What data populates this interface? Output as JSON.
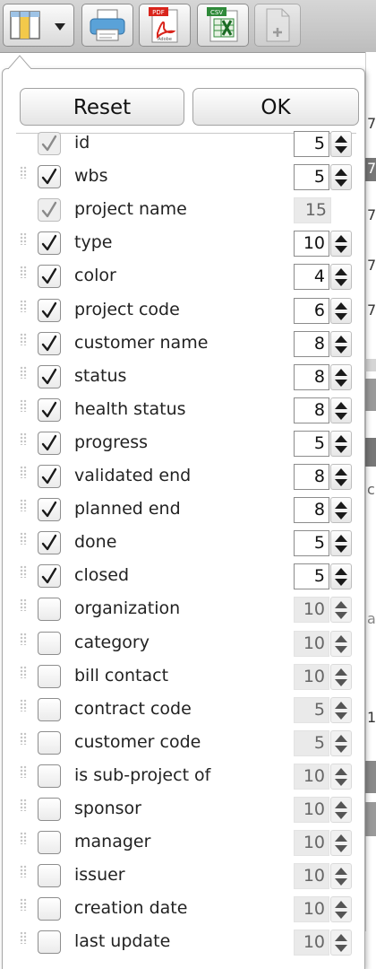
{
  "toolbar": {
    "buttons": [
      {
        "icon": "column-selector-icon",
        "has_dropdown": true
      },
      {
        "icon": "printer-icon"
      },
      {
        "icon": "pdf-export-icon",
        "badge": "PDF",
        "sub": "Adobe"
      },
      {
        "icon": "csv-export-icon",
        "badge": "CSV"
      },
      {
        "icon": "new-document-icon",
        "disabled": true
      }
    ]
  },
  "background": {
    "fragments": [
      "7",
      "7",
      "7",
      "7",
      "7",
      "c",
      "a",
      "1"
    ]
  },
  "popup": {
    "reset_label": "Reset",
    "ok_label": "OK",
    "columns": [
      {
        "label": "id",
        "checked": true,
        "locked": true,
        "width": "5",
        "editable": true
      },
      {
        "label": "wbs",
        "checked": true,
        "locked": false,
        "width": "5",
        "editable": true
      },
      {
        "label": "project name",
        "checked": true,
        "locked": true,
        "width": "15",
        "editable": false
      },
      {
        "label": "type",
        "checked": true,
        "locked": false,
        "width": "10",
        "editable": true
      },
      {
        "label": "color",
        "checked": true,
        "locked": false,
        "width": "4",
        "editable": true
      },
      {
        "label": "project code",
        "checked": true,
        "locked": false,
        "width": "6",
        "editable": true
      },
      {
        "label": "customer name",
        "checked": true,
        "locked": false,
        "width": "8",
        "editable": true
      },
      {
        "label": "status",
        "checked": true,
        "locked": false,
        "width": "8",
        "editable": true
      },
      {
        "label": "health status",
        "checked": true,
        "locked": false,
        "width": "8",
        "editable": true
      },
      {
        "label": "progress",
        "checked": true,
        "locked": false,
        "width": "5",
        "editable": true
      },
      {
        "label": "validated end",
        "checked": true,
        "locked": false,
        "width": "8",
        "editable": true
      },
      {
        "label": "planned end",
        "checked": true,
        "locked": false,
        "width": "8",
        "editable": true
      },
      {
        "label": "done",
        "checked": true,
        "locked": false,
        "width": "5",
        "editable": true
      },
      {
        "label": "closed",
        "checked": true,
        "locked": false,
        "width": "5",
        "editable": true
      },
      {
        "label": "organization",
        "checked": false,
        "locked": false,
        "width": "10",
        "editable": false
      },
      {
        "label": "category",
        "checked": false,
        "locked": false,
        "width": "10",
        "editable": false
      },
      {
        "label": "bill contact",
        "checked": false,
        "locked": false,
        "width": "10",
        "editable": false
      },
      {
        "label": "contract code",
        "checked": false,
        "locked": false,
        "width": "5",
        "editable": false
      },
      {
        "label": "customer code",
        "checked": false,
        "locked": false,
        "width": "5",
        "editable": false
      },
      {
        "label": "is sub-project of",
        "checked": false,
        "locked": false,
        "width": "10",
        "editable": false
      },
      {
        "label": "sponsor",
        "checked": false,
        "locked": false,
        "width": "10",
        "editable": false
      },
      {
        "label": "manager",
        "checked": false,
        "locked": false,
        "width": "10",
        "editable": false
      },
      {
        "label": "issuer",
        "checked": false,
        "locked": false,
        "width": "10",
        "editable": false
      },
      {
        "label": "creation date",
        "checked": false,
        "locked": false,
        "width": "10",
        "editable": false
      },
      {
        "label": "last update",
        "checked": false,
        "locked": false,
        "width": "10",
        "editable": false
      }
    ]
  }
}
